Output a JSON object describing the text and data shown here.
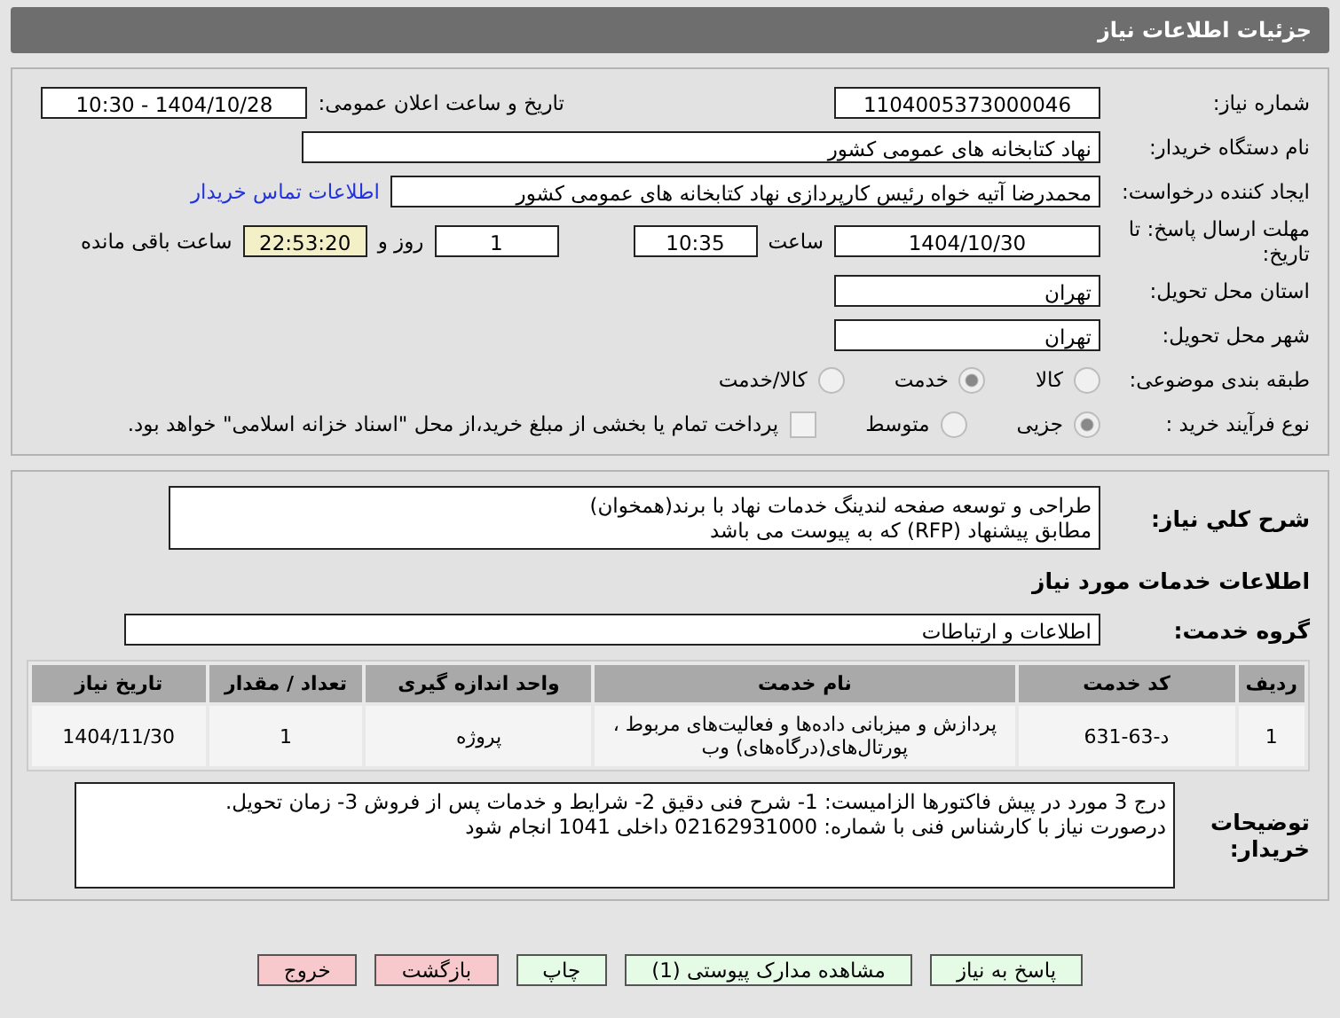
{
  "window": {
    "title": "جزئیات اطلاعات نیاز"
  },
  "need_number": {
    "label": "شماره نیاز:",
    "value": "1104005373000046"
  },
  "announce": {
    "label": "تاریخ و ساعت اعلان عمومی:",
    "value": "1404/10/28 - 10:30"
  },
  "buyer_org": {
    "label": "نام دستگاه خریدار:",
    "value": "نهاد کتابخانه های عمومی کشور"
  },
  "requester": {
    "label": "ایجاد کننده درخواست:",
    "value": "محمدرضا آتیه خواه  رئیس کارپردازی نهاد کتابخانه های عمومی کشور",
    "link": "اطلاعات تماس خریدار"
  },
  "deadline": {
    "label": "مهلت ارسال پاسخ: تا تاریخ:",
    "date": "1404/10/30",
    "time_label": "ساعت",
    "time": "10:35",
    "days": "1",
    "days_label": "روز و",
    "remaining": "22:53:20",
    "remaining_label": "ساعت باقی مانده"
  },
  "province": {
    "label": "استان محل تحویل:",
    "value": "تهران"
  },
  "city": {
    "label": "شهر محل تحویل:",
    "value": "تهران"
  },
  "category": {
    "label": "طبقه بندی موضوعی:",
    "options": [
      {
        "label": "کالا",
        "selected": false
      },
      {
        "label": "خدمت",
        "selected": true
      },
      {
        "label": "کالا/خدمت",
        "selected": false
      }
    ]
  },
  "purchase_type": {
    "label": "نوع فرآیند خرید :",
    "options": [
      {
        "label": "جزیی",
        "selected": true
      },
      {
        "label": "متوسط",
        "selected": false
      }
    ],
    "payment_note": {
      "label": "پرداخت تمام یا بخشی از مبلغ خرید،از محل \"اسناد خزانه اسلامی\" خواهد بود.",
      "checked": false
    }
  },
  "description": {
    "label": "شرح کلي نیاز:",
    "lines": [
      "طراحی و توسعه صفحه لندینگ خدمات نهاد با برند(همخوان)",
      "مطابق پیشنهاد (RFP) که به پیوست می باشد"
    ]
  },
  "services_heading": "اطلاعات خدمات مورد نیاز",
  "service_group": {
    "label": "گروه خدمت:",
    "value": "اطلاعات و ارتباطات"
  },
  "table": {
    "columns": [
      "ردیف",
      "کد خدمت",
      "نام خدمت",
      "واحد اندازه گیری",
      "تعداد / مقدار",
      "تاریخ نیاز"
    ],
    "rows": [
      [
        "1",
        "د-63-631",
        "پردازش و میزبانی داده‌ها و فعالیت‌های مربوط ، پورتال‌های(درگاه‌های) وب",
        "پروژه",
        "1",
        "1404/11/30"
      ]
    ]
  },
  "buyer_notes": {
    "label": "توضیحات خریدار:",
    "lines": [
      "درج 3 مورد در پیش فاکتورها الزامیست: 1- شرح فنی دقیق 2- شرایط و خدمات پس از فروش 3- زمان تحویل.",
      "درصورت نیاز با کارشناس فنی با شماره: 02162931000 داخلی 1041 انجام شود"
    ]
  },
  "buttons": [
    {
      "label": "پاسخ به نیاز",
      "kind": "primary"
    },
    {
      "label": "مشاهده مدارک پیوستی (1)",
      "kind": "primary"
    },
    {
      "label": "چاپ",
      "kind": "primary"
    },
    {
      "label": "بازگشت",
      "kind": "danger"
    },
    {
      "label": "خروج",
      "kind": "danger"
    }
  ]
}
